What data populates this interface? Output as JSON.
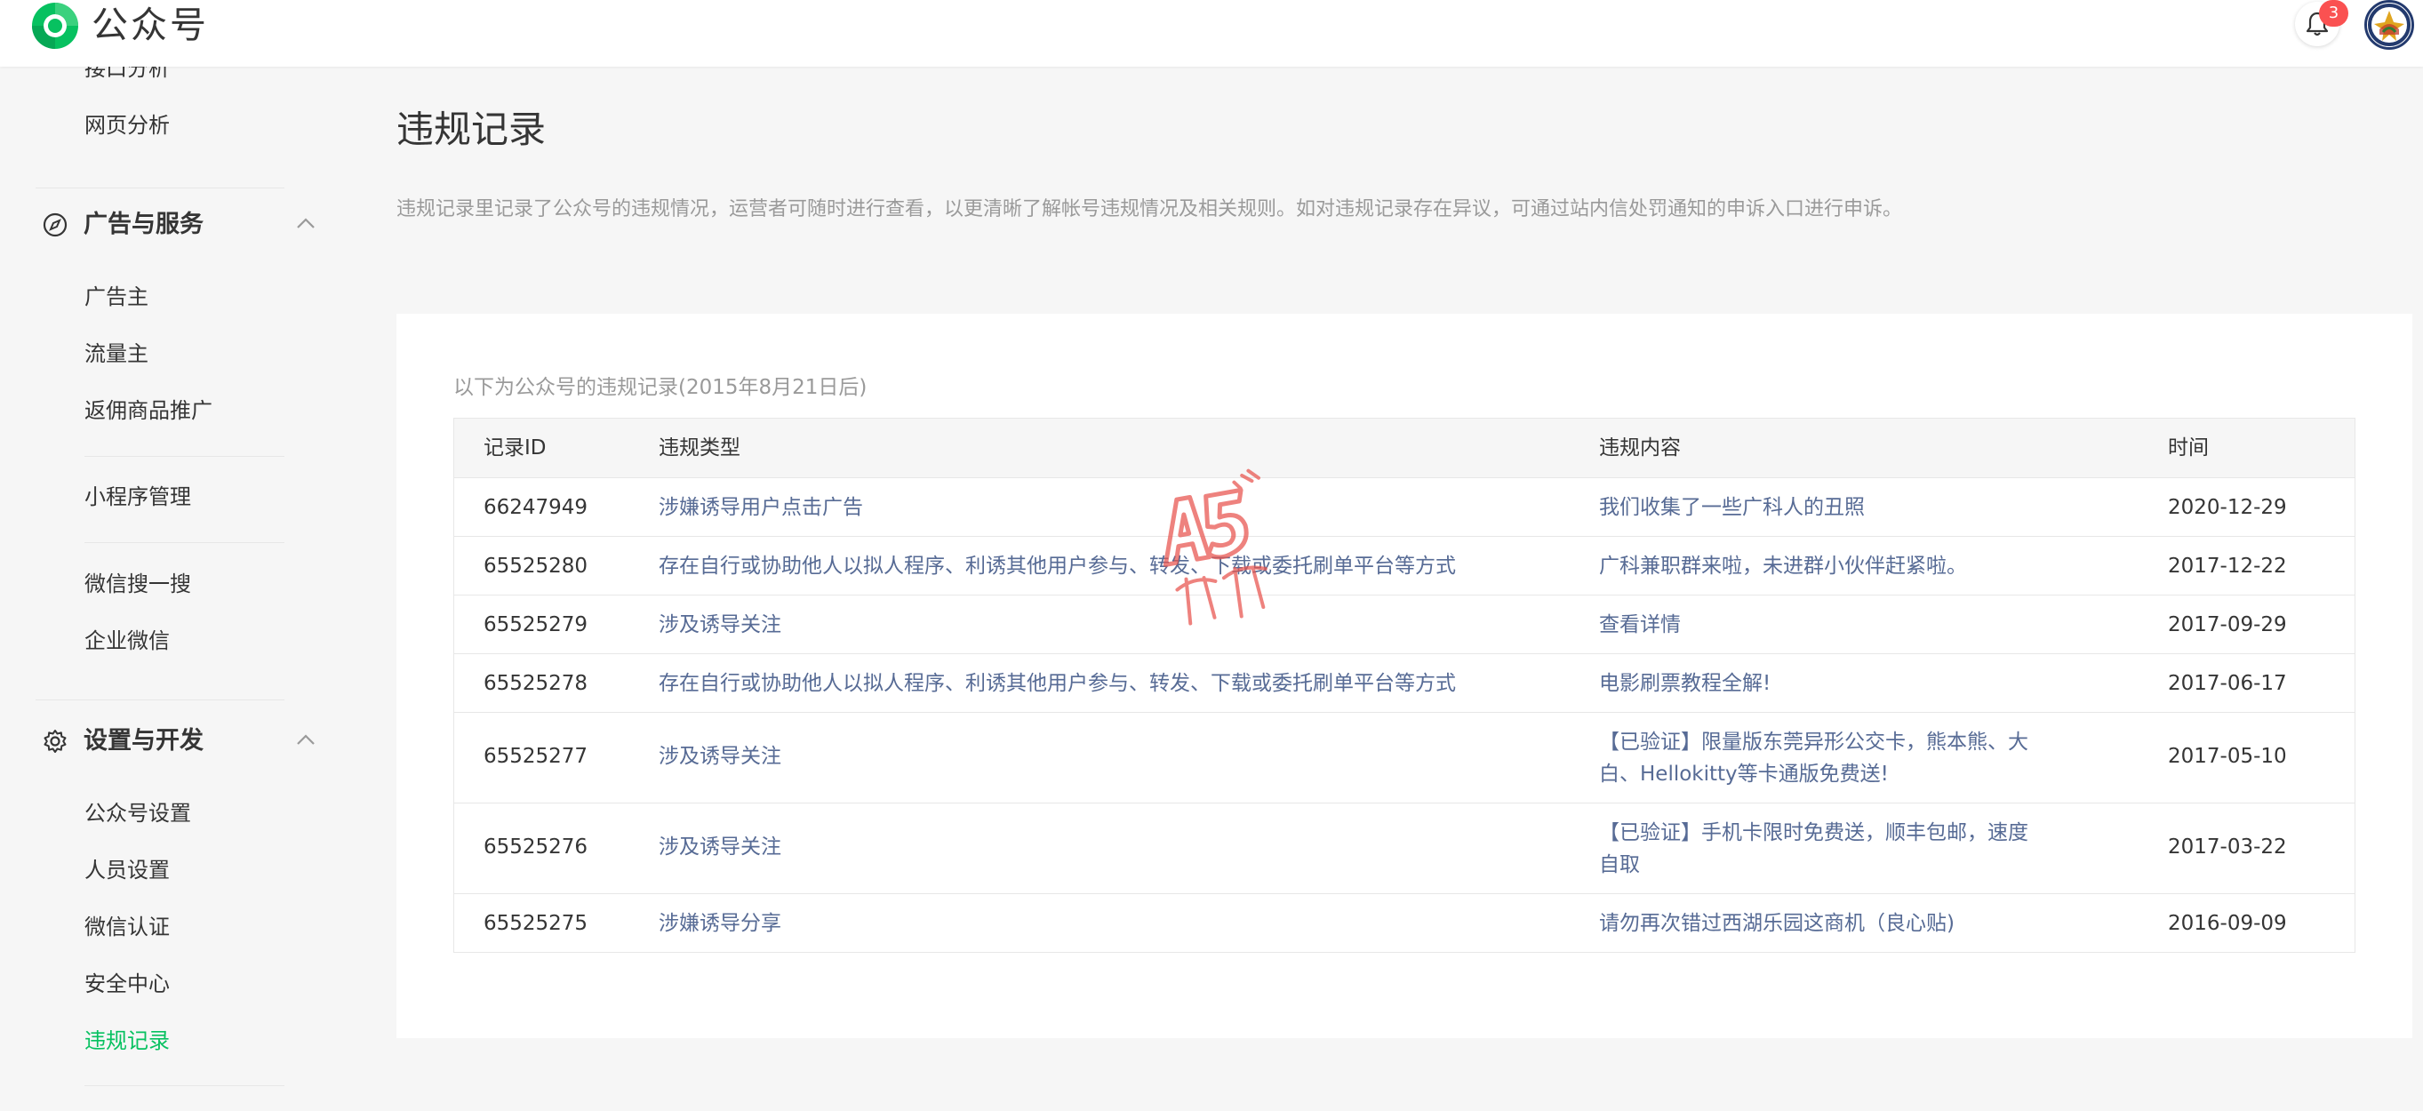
{
  "header": {
    "brand": "公众号",
    "notification_count": "3"
  },
  "sidebar": {
    "top_items": [
      "接口分析",
      "网页分析"
    ],
    "groups": [
      {
        "label": "广告与服务",
        "icon": "compass-icon",
        "items": [
          "广告主",
          "流量主",
          "返佣商品推广"
        ]
      },
      {
        "label": "设置与开发",
        "icon": "gear-icon",
        "items": [
          "公众号设置",
          "人员设置",
          "微信认证",
          "安全中心",
          "违规记录"
        ]
      }
    ],
    "standalone": [
      "小程序管理",
      "微信搜一搜",
      "企业微信"
    ],
    "active_item": "违规记录",
    "accent_color": "#07c160"
  },
  "main": {
    "title": "违规记录",
    "description": "违规记录里记录了公众号的违规情况，运营者可随时进行查看，以更清晰了解帐号违规情况及相关规则。如对违规记录存在异议，可通过站内信处罚通知的申诉入口进行申诉。",
    "table_caption": "以下为公众号的违规记录(2015年8月21日后)",
    "columns": [
      "记录ID",
      "违规类型",
      "违规内容",
      "时间"
    ],
    "rows": [
      {
        "id": "66247949",
        "type": "涉嫌诱导用户点击广告",
        "content": "我们收集了一些广科人的丑照",
        "time": "2020-12-29"
      },
      {
        "id": "65525280",
        "type": "存在自行或协助他人以拟人程序、利诱其他用户参与、转发、下载或委托刷单平台等方式",
        "content": "广科兼职群来啦，未进群小伙伴赶紧啦。",
        "time": "2017-12-22"
      },
      {
        "id": "65525279",
        "type": "涉及诱导关注",
        "content": "查看详情",
        "time": "2017-09-29"
      },
      {
        "id": "65525278",
        "type": "存在自行或协助他人以拟人程序、利诱其他用户参与、转发、下载或委托刷单平台等方式",
        "content": "电影刷票教程全解!",
        "time": "2017-06-17"
      },
      {
        "id": "65525277",
        "type": "涉及诱导关注",
        "content": "【已验证】限量版东莞异形公交卡，熊本熊、大白、Hellokitty等卡通版免费送!",
        "time": "2017-05-10"
      },
      {
        "id": "65525276",
        "type": "涉及诱导关注",
        "content": "【已验证】手机卡限时免费送，顺丰包邮，速度自取",
        "time": "2017-03-22"
      },
      {
        "id": "65525275",
        "type": "涉嫌诱导分享",
        "content": "请勿再次错过西湖乐园这商机（良心贴)",
        "time": "2016-09-09"
      }
    ],
    "link_color": "#576b95"
  },
  "watermark": {
    "text": "A5 新媒体"
  }
}
